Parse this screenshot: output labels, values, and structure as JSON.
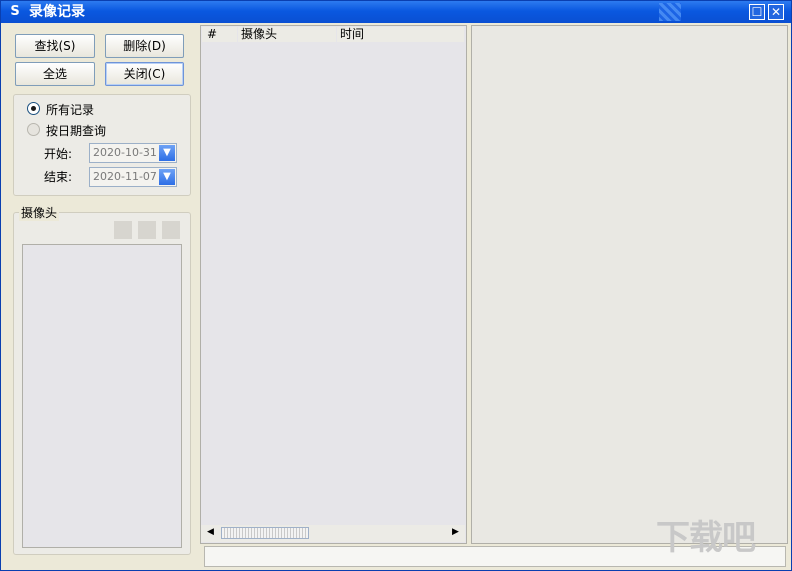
{
  "window": {
    "title": "录像记录",
    "app_icon": "S"
  },
  "titlebar_buttons": {
    "maximize": "☐",
    "close": "✕"
  },
  "toolbar": {
    "search": "查找(S)",
    "delete": "删除(D)",
    "select_all": "全选",
    "close": "关闭(C)"
  },
  "filter": {
    "all_records": "所有记录",
    "by_date": "按日期查询",
    "start_label": "开始:",
    "end_label": "结束:",
    "start_date": "2020-10-31",
    "end_date": "2020-11-07",
    "selected": "all_records"
  },
  "camera_group": {
    "title": "摄像头"
  },
  "record_table": {
    "columns": [
      "#",
      "摄像头",
      "时间"
    ]
  },
  "watermark": "下载吧"
}
